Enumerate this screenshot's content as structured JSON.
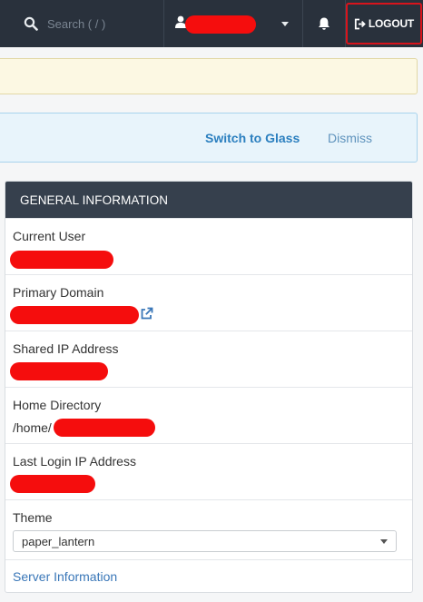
{
  "topbar": {
    "search_placeholder": "Search ( / )",
    "logout_label": "LOGOUT",
    "icons": [
      "search-icon",
      "user-icon",
      "chevron-down-icon",
      "bell-icon",
      "logout-icon"
    ]
  },
  "notices": {
    "switch_label": "Switch to Glass",
    "dismiss_label": "Dismiss"
  },
  "general_information": {
    "title": "GENERAL INFORMATION",
    "current_user_label": "Current User",
    "primary_domain_label": "Primary Domain",
    "shared_ip_label": "Shared IP Address",
    "home_directory_label": "Home Directory",
    "home_directory_prefix": "/home/",
    "last_login_ip_label": "Last Login IP Address",
    "theme_label": "Theme",
    "theme_selected": "paper_lantern",
    "server_information_link": "Server Information"
  },
  "colors": {
    "topbar_bg": "#29313c",
    "panel_header_bg": "#36404d",
    "redaction": "#f50d0d",
    "logout_border": "#d8141c",
    "link": "#3a77b8"
  }
}
